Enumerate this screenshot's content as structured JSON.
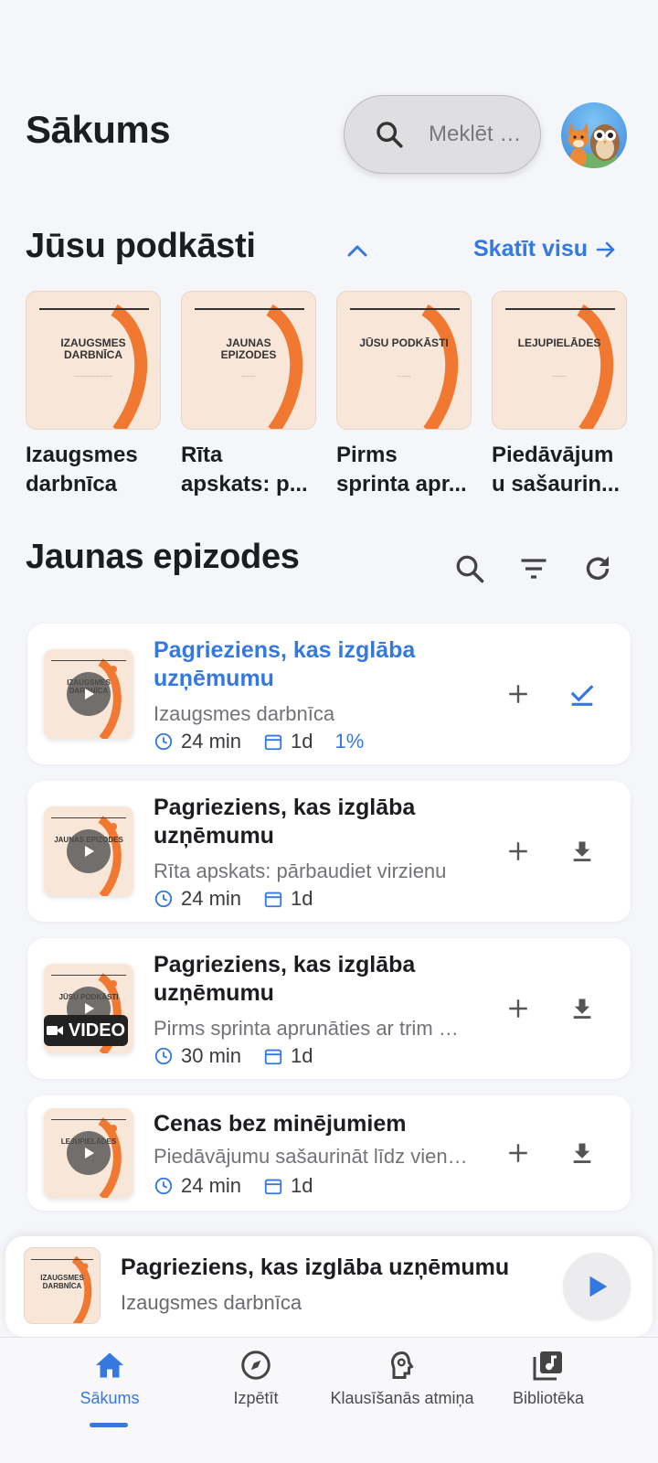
{
  "header": {
    "title": "Sākums",
    "search_placeholder": "Meklēt p..."
  },
  "podcasts_section": {
    "title": "Jūsu podkāsti",
    "see_all_label": "Skatīt visu",
    "items": [
      {
        "cover_text": "IZAUGSMES DARBNĪCA",
        "name_line1": "Izaugsmes",
        "name_line2": "darbnīca"
      },
      {
        "cover_text": "JAUNAS EPIZODES",
        "name_line1": "Rīta",
        "name_line2": "apskats: p..."
      },
      {
        "cover_text": "JŪSU PODKĀSTI",
        "name_line1": "Pirms",
        "name_line2": "sprinta apr..."
      },
      {
        "cover_text": "LEJUPIELĀDES",
        "name_line1": "Piedāvājum",
        "name_line2": "u sašaurin..."
      }
    ]
  },
  "episodes_section": {
    "title": "Jaunas epizodes",
    "icons": [
      "search-icon",
      "filter-icon",
      "refresh-icon"
    ],
    "items": [
      {
        "thumb_text": "IZAUGSMES DARBNĪCA",
        "title_line1": "Pagrieziens, kas izglāba",
        "title_line2": "uzņēmumu",
        "podcast": "Izaugsmes darbnīca",
        "duration": "24 min",
        "age": "1d",
        "progress": "1%",
        "active": true,
        "action_icon": "check-icon"
      },
      {
        "thumb_text": "JAUNAS EPIZODES",
        "title_line1": "Pagrieziens, kas izglāba",
        "title_line2": "uzņēmumu",
        "podcast": "Rīta apskats: pārbaudiet virzienu",
        "duration": "24 min",
        "age": "1d",
        "action_icon": "download-icon"
      },
      {
        "thumb_text": "JŪSU PODKĀSTI",
        "title_line1": "Pagrieziens, kas izglāba",
        "title_line2": "uzņēmumu",
        "podcast": "Pirms sprinta aprunāties ar trim …",
        "duration": "30 min",
        "age": "1d",
        "badge": "VIDEO",
        "action_icon": "download-icon"
      },
      {
        "thumb_text": "LEJUPIELĀDES",
        "title_line1": "Cenas bez minējumiem",
        "podcast": "Piedāvājumu sašaurināt līdz vien…",
        "duration": "24 min",
        "age": "1d",
        "action_icon": "download-icon"
      }
    ]
  },
  "mini_player": {
    "thumb_text": "IZAUGSMES DARBNĪCA",
    "title": "Pagrieziens, kas izglāba uzņēmumu",
    "podcast": "Izaugsmes darbnīca"
  },
  "bottom_nav": {
    "items": [
      {
        "label": "Sākums",
        "icon": "home-icon",
        "active": true
      },
      {
        "label": "Izpētīt",
        "icon": "compass-icon"
      },
      {
        "label": "Klausīšanās atmiņa",
        "icon": "brain-icon"
      },
      {
        "label": "Bibliotēka",
        "icon": "library-icon"
      }
    ]
  },
  "colors": {
    "accent": "#3478e0",
    "cover_bg": "#f8e6d8",
    "cover_arc": "#f07830"
  }
}
